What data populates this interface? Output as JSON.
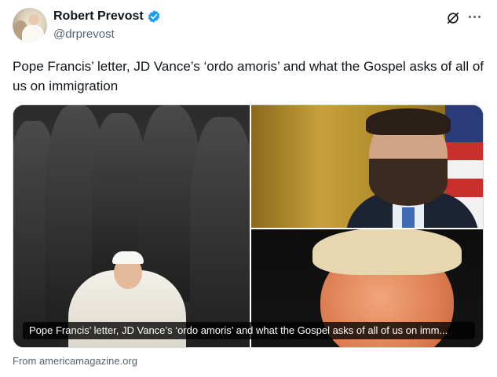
{
  "author": {
    "name": "Robert Prevost",
    "handle": "@drprevost",
    "verified_color": "#1d9bf0"
  },
  "actions": {
    "grok_icon": "slashed-circle-icon",
    "more_icon": "ellipsis-icon"
  },
  "tweet": {
    "text": "Pope Francis’ letter, JD Vance’s ‘ordo amoris’ and what the Gospel asks of all of us on immigration"
  },
  "link_card": {
    "caption": "Pope Francis’ letter, JD Vance’s ‘ordo amoris’ and what the Gospel asks of all of us on imm...",
    "source": "From americamagazine.org"
  }
}
